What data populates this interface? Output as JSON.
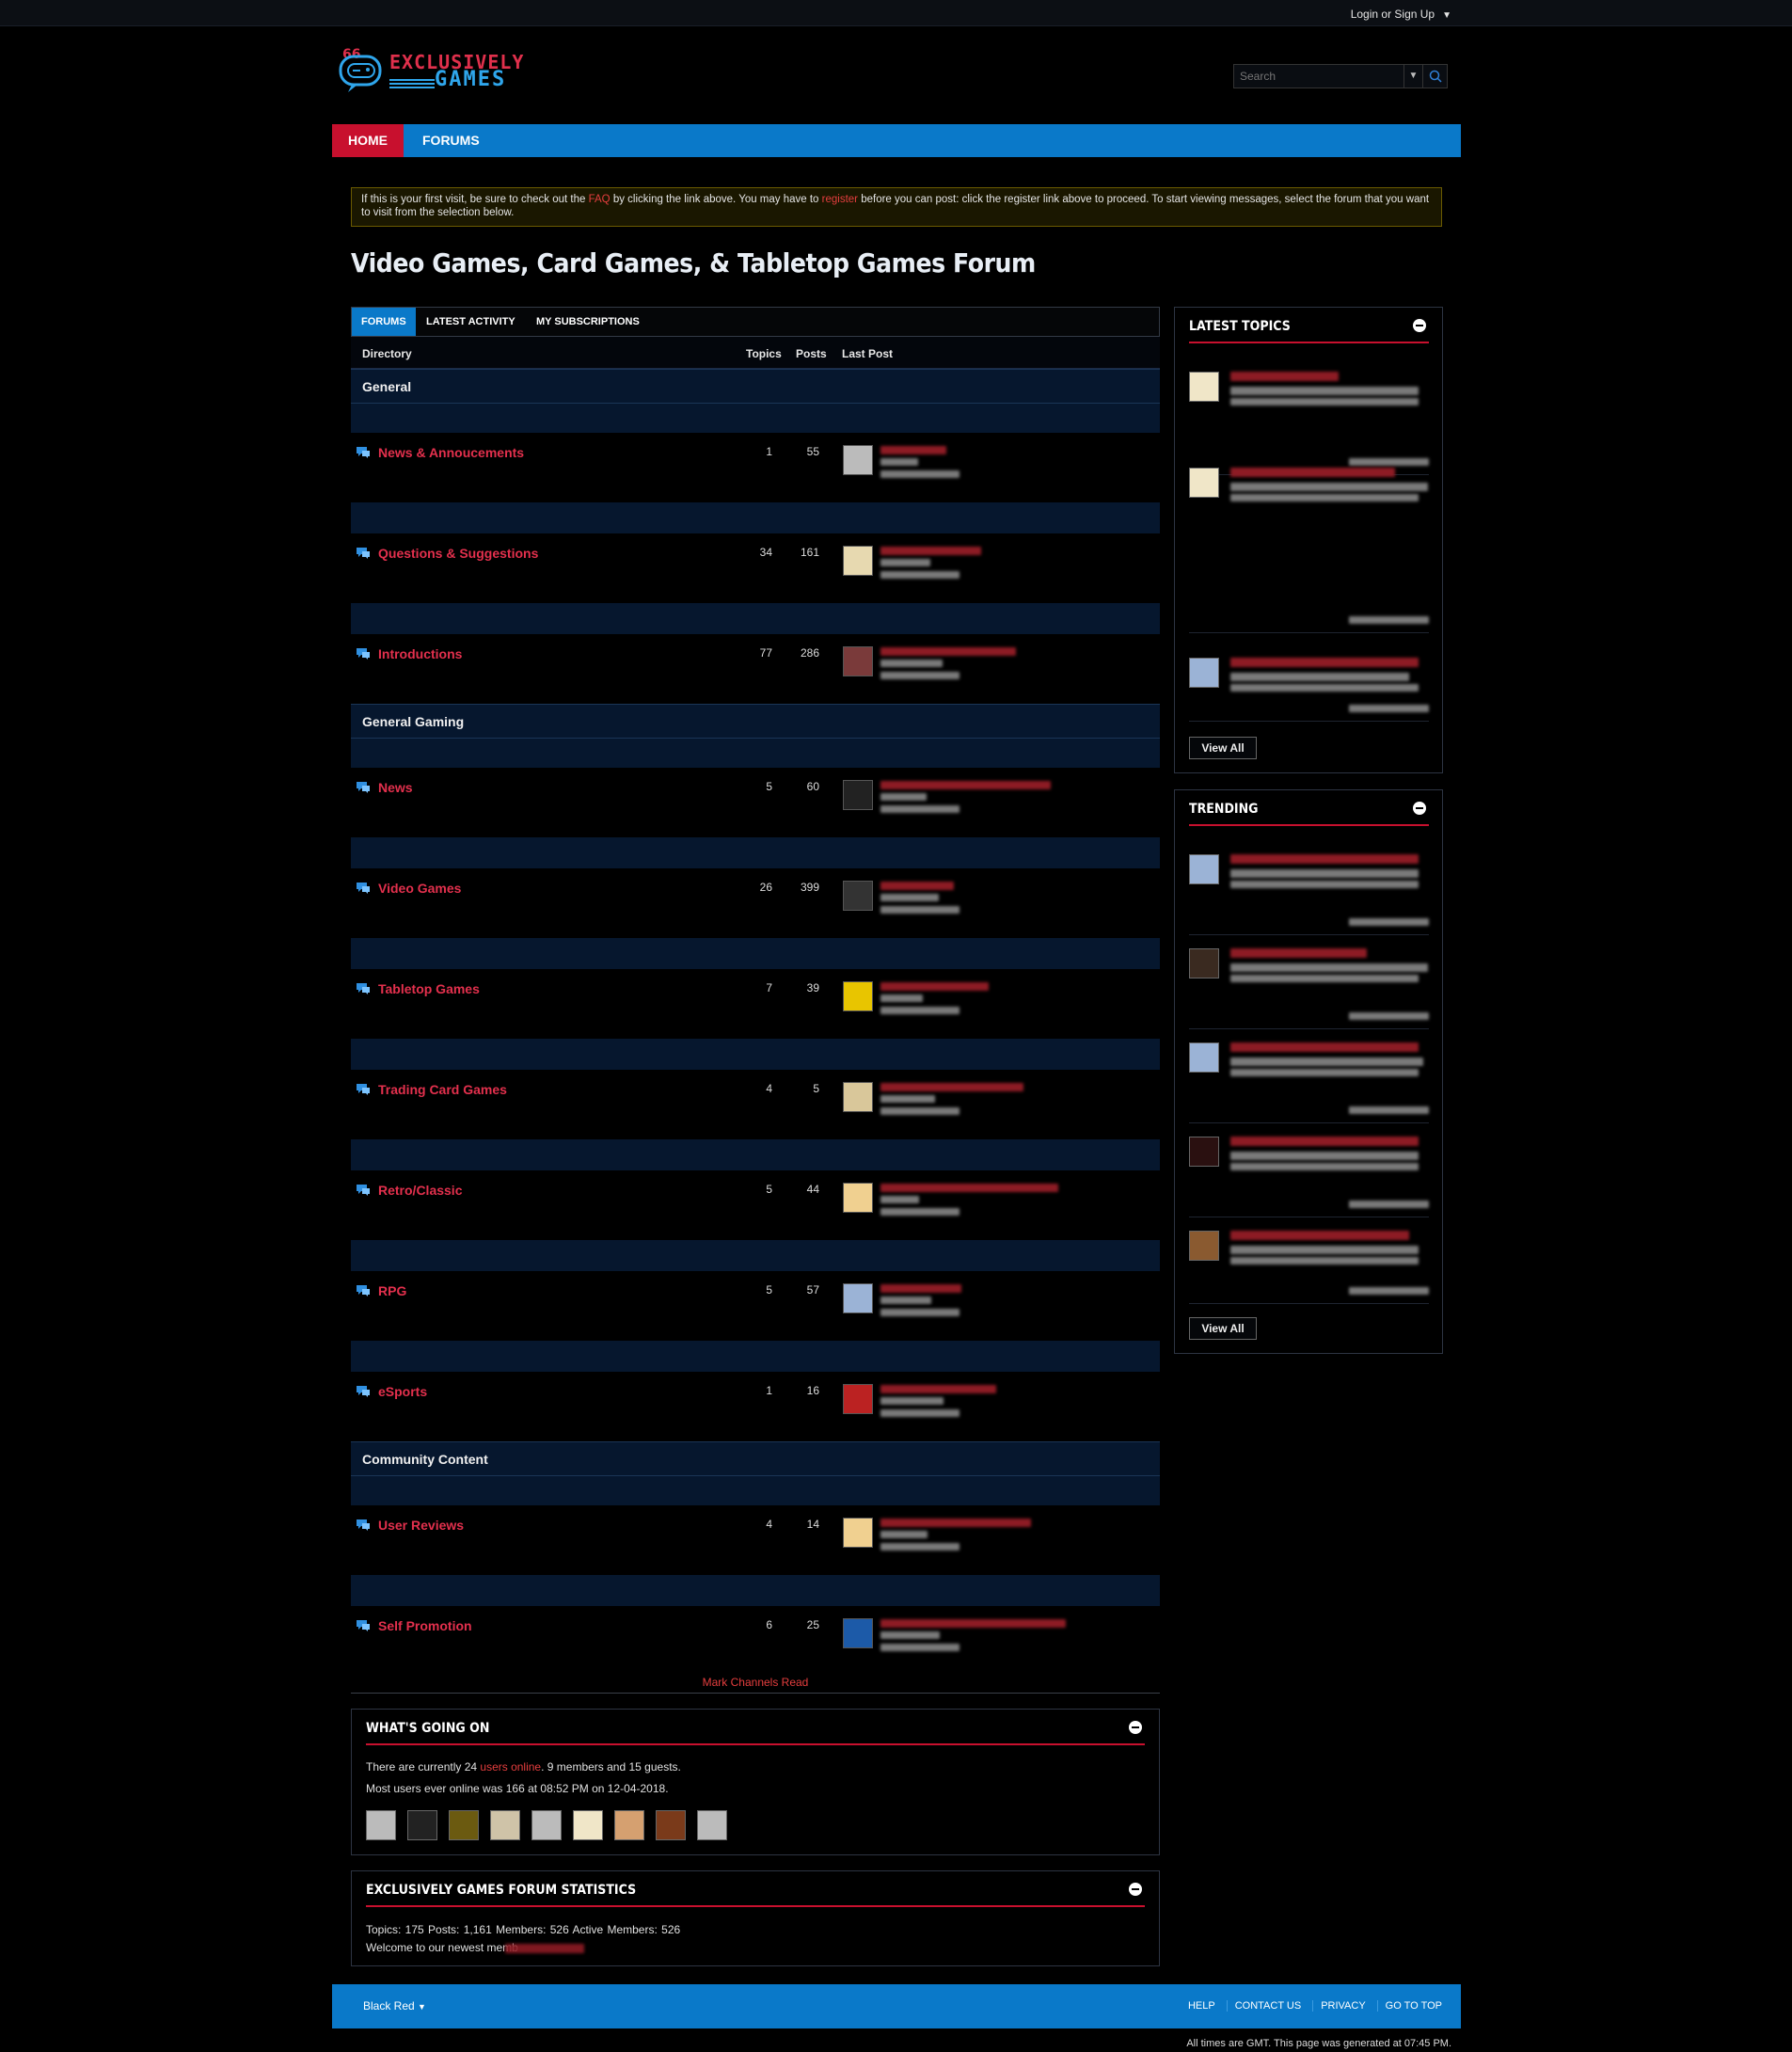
{
  "header": {
    "login_label": "Login or Sign Up",
    "logo_line1": "EXCLUSIVELY",
    "logo_line2": "GAMES",
    "search_placeholder": "Search"
  },
  "nav": {
    "home": "HOME",
    "forums": "FORUMS"
  },
  "notice": {
    "part1": "If this is your first visit, be sure to check out the ",
    "faq": "FAQ",
    "part2": " by clicking the link above. You may have to ",
    "register": "register",
    "part3": " before you can post: click the register link above to proceed. To start viewing messages, select the forum that you want to visit from the selection below."
  },
  "page_title": "Video Games, Card Games, & Tabletop Games Forum",
  "tabs": [
    "FORUMS",
    "LATEST ACTIVITY",
    "MY SUBSCRIPTIONS"
  ],
  "columns": {
    "directory": "Directory",
    "topics": "Topics",
    "posts": "Posts",
    "last_post": "Last Post"
  },
  "sections": [
    "General",
    "General Gaming",
    "Community Content"
  ],
  "forums": [
    {
      "name": "News & Annoucements",
      "topics": "1",
      "posts": "55"
    },
    {
      "name": "Questions & Suggestions",
      "topics": "34",
      "posts": "161"
    },
    {
      "name": "Introductions",
      "topics": "77",
      "posts": "286"
    },
    {
      "name": "News",
      "topics": "5",
      "posts": "60"
    },
    {
      "name": "Video Games",
      "topics": "26",
      "posts": "399"
    },
    {
      "name": "Tabletop Games",
      "topics": "7",
      "posts": "39"
    },
    {
      "name": "Trading Card Games",
      "topics": "4",
      "posts": "5"
    },
    {
      "name": "Retro/Classic",
      "topics": "5",
      "posts": "44"
    },
    {
      "name": "RPG",
      "topics": "5",
      "posts": "57"
    },
    {
      "name": "eSports",
      "topics": "1",
      "posts": "16"
    },
    {
      "name": "User Reviews",
      "topics": "4",
      "posts": "14"
    },
    {
      "name": "Self Promotion",
      "topics": "6",
      "posts": "25"
    }
  ],
  "mark_read": "Mark Channels Read",
  "whats_going_on": {
    "title": "WHAT'S GOING ON",
    "line1_a": "There are currently 24 ",
    "line1_link": "users online",
    "line1_b": ". 9 members and 15 guests.",
    "line2": "Most users ever online was 166 at 08:52 PM on 12-04-2018."
  },
  "stats": {
    "title": "EXCLUSIVELY GAMES FORUM STATISTICS",
    "line1": "Topics: 175   Posts: 1,161   Members: 526   Active Members: 526",
    "line2": "Welcome to our newest memb"
  },
  "latest_topics": {
    "title": "LATEST TOPICS",
    "view_all": "View All"
  },
  "trending": {
    "title": "TRENDING",
    "view_all": "View All"
  },
  "footer": {
    "theme": "Black Red",
    "links": [
      "HELP",
      "CONTACT US",
      "PRIVACY",
      "GO TO TOP"
    ],
    "gmt": "All times are GMT. This page was generated at 07:45 PM."
  },
  "colors": {
    "brand_blue": "#0a79c9",
    "brand_red": "#c8102e",
    "link_red": "#e3304d",
    "section_bg": "#06172e"
  }
}
